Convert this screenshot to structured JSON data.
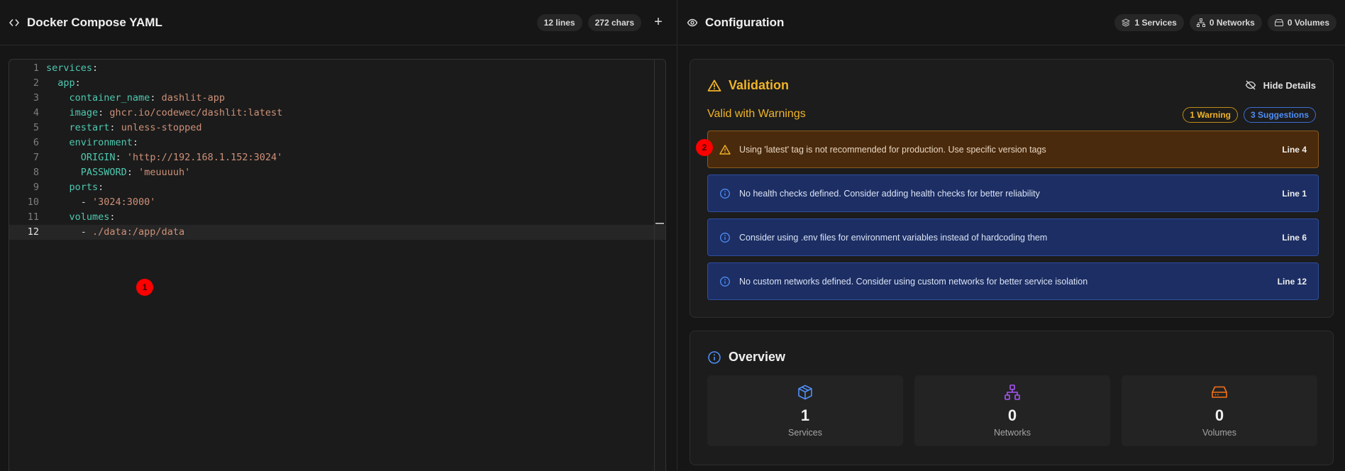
{
  "editor": {
    "title": "Docker Compose YAML",
    "lines_badge": "12 lines",
    "chars_badge": "272 chars",
    "add_label": "+",
    "code": [
      {
        "num": "1",
        "parts": [
          [
            "k",
            "services"
          ],
          [
            "p",
            ":"
          ]
        ]
      },
      {
        "num": "2",
        "parts": [
          [
            "d",
            "  "
          ],
          [
            "k",
            "app"
          ],
          [
            "p",
            ":"
          ]
        ]
      },
      {
        "num": "3",
        "parts": [
          [
            "d",
            "    "
          ],
          [
            "k",
            "container_name"
          ],
          [
            "p",
            ": "
          ],
          [
            "s",
            "dashlit-app"
          ]
        ]
      },
      {
        "num": "4",
        "parts": [
          [
            "d",
            "    "
          ],
          [
            "k",
            "image"
          ],
          [
            "p",
            ": "
          ],
          [
            "s",
            "ghcr.io/codewec/dashlit:latest"
          ]
        ]
      },
      {
        "num": "5",
        "parts": [
          [
            "d",
            "    "
          ],
          [
            "k",
            "restart"
          ],
          [
            "p",
            ": "
          ],
          [
            "s",
            "unless-stopped"
          ]
        ]
      },
      {
        "num": "6",
        "parts": [
          [
            "d",
            "    "
          ],
          [
            "k",
            "environment"
          ],
          [
            "p",
            ":"
          ]
        ]
      },
      {
        "num": "7",
        "parts": [
          [
            "d",
            "      "
          ],
          [
            "k",
            "ORIGIN"
          ],
          [
            "p",
            ": "
          ],
          [
            "s",
            "'http://192.168.1.152:3024'"
          ]
        ]
      },
      {
        "num": "8",
        "parts": [
          [
            "d",
            "      "
          ],
          [
            "k",
            "PASSWORD"
          ],
          [
            "p",
            ": "
          ],
          [
            "s",
            "'meuuuuh'"
          ]
        ]
      },
      {
        "num": "9",
        "parts": [
          [
            "d",
            "    "
          ],
          [
            "k",
            "ports"
          ],
          [
            "p",
            ":"
          ]
        ]
      },
      {
        "num": "10",
        "parts": [
          [
            "d",
            "      - "
          ],
          [
            "s",
            "'3024:3000'"
          ]
        ]
      },
      {
        "num": "11",
        "parts": [
          [
            "d",
            "    "
          ],
          [
            "k",
            "volumes"
          ],
          [
            "p",
            ":"
          ]
        ]
      },
      {
        "num": "12",
        "parts": [
          [
            "d",
            "      - "
          ],
          [
            "s",
            "./data:/app/data"
          ]
        ]
      }
    ],
    "active_line": 12
  },
  "config": {
    "title": "Configuration",
    "services_badge": "1 Services",
    "networks_badge": "0 Networks",
    "volumes_badge": "0 Volumes"
  },
  "validation": {
    "title": "Validation",
    "hide_label": "Hide Details",
    "status": "Valid with Warnings",
    "warning_badge": "1 Warning",
    "suggestion_badge": "3 Suggestions",
    "issues": [
      {
        "type": "warning",
        "message": "Using 'latest' tag is not recommended for production. Use specific version tags",
        "line": "Line 4"
      },
      {
        "type": "suggest",
        "message": "No health checks defined. Consider adding health checks for better reliability",
        "line": "Line 1"
      },
      {
        "type": "suggest",
        "message": "Consider using .env files for environment variables instead of hardcoding them",
        "line": "Line 6"
      },
      {
        "type": "suggest",
        "message": "No custom networks defined. Consider using custom networks for better service isolation",
        "line": "Line 12"
      }
    ]
  },
  "overview": {
    "title": "Overview",
    "stats": [
      {
        "value": "1",
        "label": "Services",
        "icon": "box-icon",
        "color": "#4f8ef7"
      },
      {
        "value": "0",
        "label": "Networks",
        "icon": "network-icon",
        "color": "#a855f7"
      },
      {
        "value": "0",
        "label": "Volumes",
        "icon": "hard-drive-icon",
        "color": "#f97316"
      }
    ]
  },
  "markers": [
    "1",
    "2"
  ],
  "colors": {
    "warning": "#f0b429",
    "info": "#4f8ef7",
    "background": "#161616"
  }
}
